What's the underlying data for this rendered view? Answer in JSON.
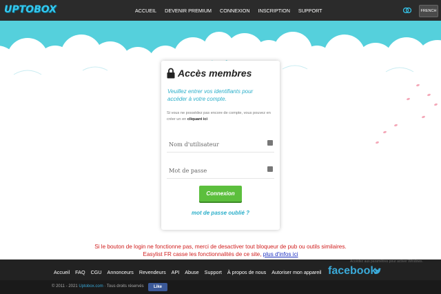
{
  "header": {
    "logo_text": "UPTOBOX",
    "nav": [
      "ACCUEIL",
      "DEVENIR PREMIUM",
      "CONNEXION",
      "INSCRIPTION",
      "SUPPORT"
    ],
    "lang_label": "FRENCH"
  },
  "login": {
    "title": "Accès membres",
    "subtitle": "Veuillez entrer vos identifiants pour accéder à votre compte.",
    "info_text": "Si vous ne possédez pas encore de compte, vous pouvez en créer un en",
    "info_link": "cliquant ici",
    "username_placeholder": "Nom d'utilisateur",
    "password_placeholder": "Mot de passe",
    "submit_label": "Connexion",
    "forgot_label": "mot de passe oublié ?"
  },
  "warning": {
    "line1": "Si le bouton de login ne fonctionne pas, merci de desactiver tout bloqueur de pub ou outils similaires.",
    "line2": "Easylist FR casse les fonctionnalités de ce site,",
    "link": "plus d'infos ici"
  },
  "footer": {
    "links": [
      "Accueil",
      "FAQ",
      "CGU",
      "Annonceurs",
      "Revendeurs",
      "API",
      "Abuse",
      "Support",
      "À propos de nous",
      "Autoriser mon appareil"
    ],
    "facebook_label": "facebook",
    "windows_note": "Accédez aux paramètres pour activer Windows.",
    "copyright_prefix": "© 2011 - 2021",
    "copyright_site": "Uptobox.com",
    "copyright_suffix": "· Tous droits réservés",
    "like_label": "Like"
  },
  "colors": {
    "accent": "#2aaec9",
    "button_green": "#5cbf3d",
    "sky": "#55d0dc",
    "warning_red": "#d01c1c",
    "topbar": "#2b2b2b"
  },
  "icons": [
    "lock-icon",
    "user-field-icon",
    "password-field-icon",
    "theme-toggle-icon",
    "twitter-bird-icon"
  ]
}
